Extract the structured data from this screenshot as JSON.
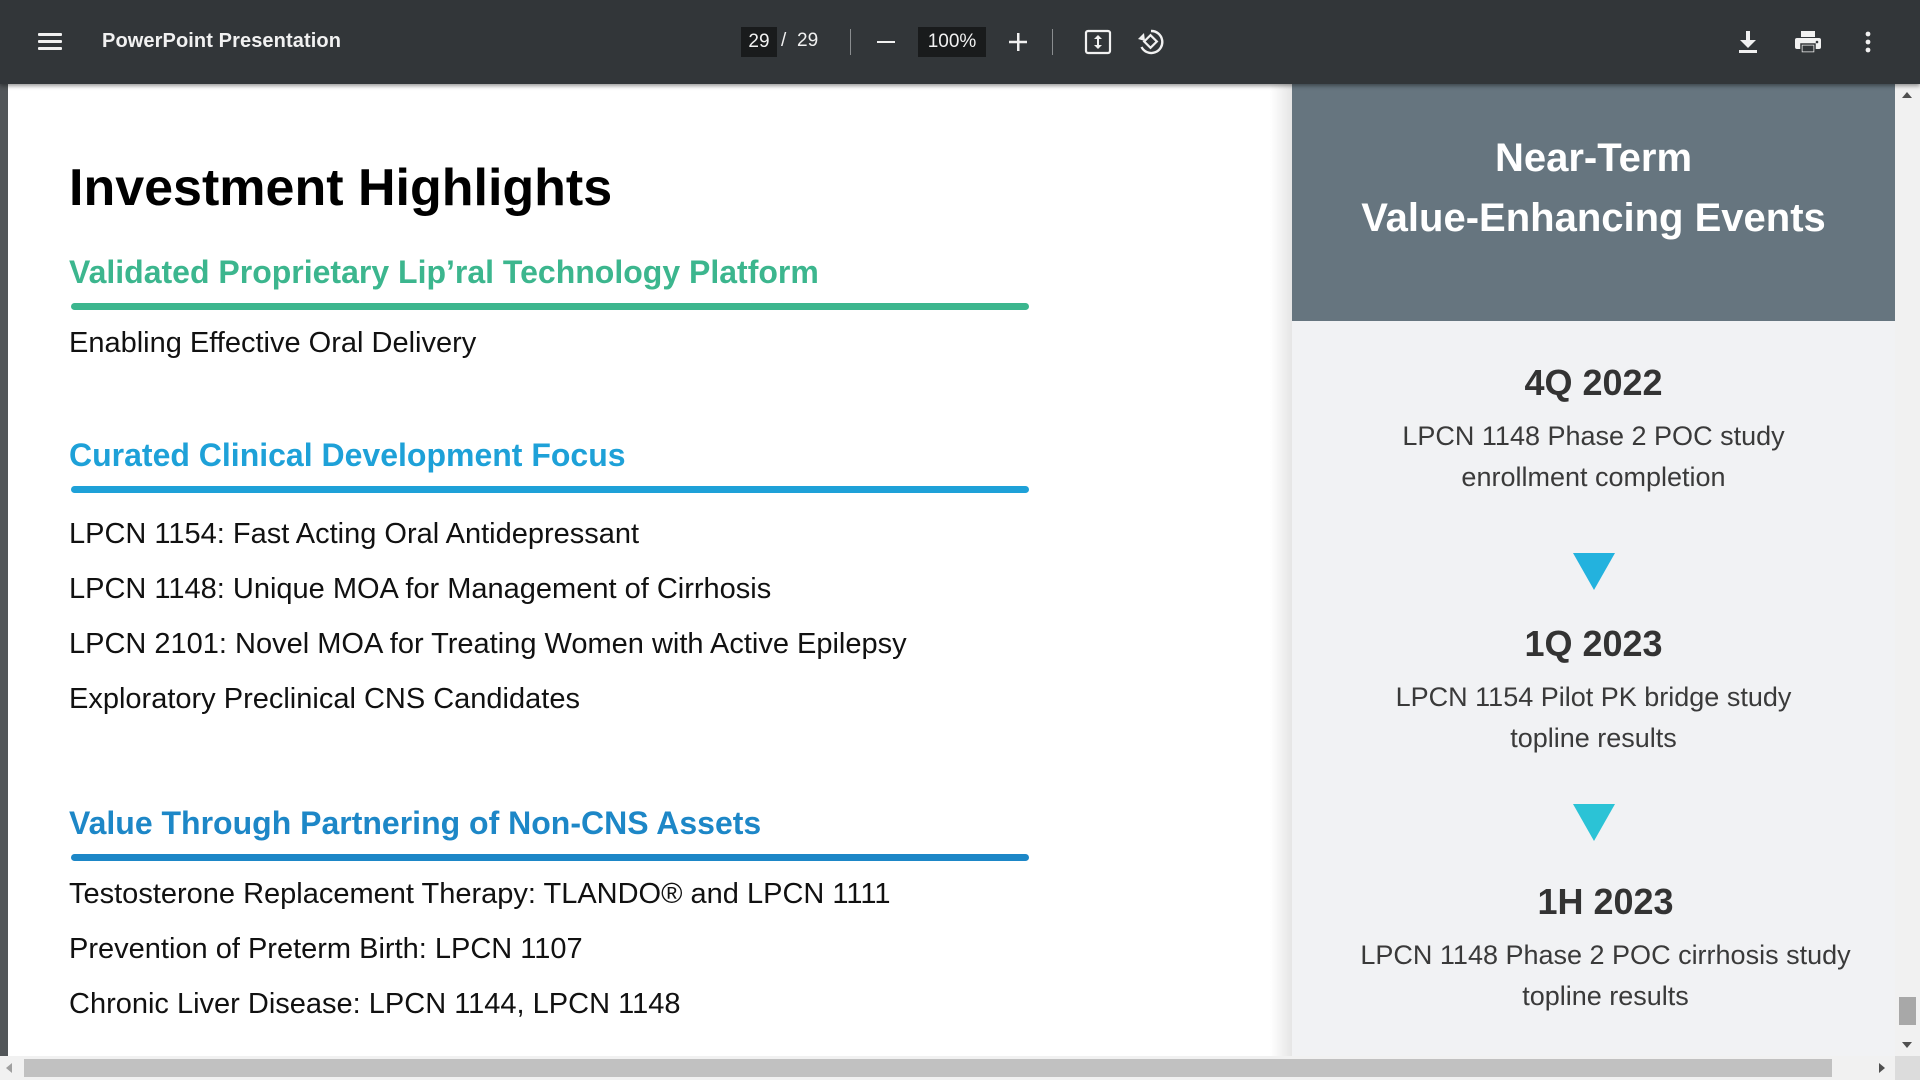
{
  "toolbar": {
    "title": "PowerPoint Presentation",
    "page_current": "29",
    "page_separator": "/",
    "page_total": "29",
    "zoom": "100%",
    "icons": {
      "menu": "hamburger-menu-icon",
      "zoom_out": "minus-icon",
      "zoom_in": "plus-icon",
      "fit": "fit-to-page-icon",
      "rotate": "rotate-counterclockwise-icon",
      "download": "download-icon",
      "print": "printer-icon",
      "more": "more-vertical-icon"
    }
  },
  "slide": {
    "title": "Investment Highlights",
    "sections": [
      {
        "heading": "Validated Proprietary Lip’ral Technology Platform",
        "color": "#3cb68e",
        "items": [
          "Enabling Effective Oral Delivery"
        ]
      },
      {
        "heading": "Curated Clinical Development Focus",
        "color": "#1ea1d8",
        "items": [
          "LPCN 1154: Fast Acting Oral Antidepressant",
          "LPCN 1148: Unique MOA for Management of Cirrhosis",
          "LPCN 2101: Novel MOA for Treating Women with Active Epilepsy",
          "Exploratory Preclinical CNS Candidates"
        ]
      },
      {
        "heading": "Value Through Partnering of Non-CNS Assets",
        "color": "#1d87c7",
        "items": [
          "Testosterone Replacement Therapy: TLANDO®  and LPCN 1111",
          "Prevention of Preterm Birth: LPCN 1107",
          "Chronic Liver Disease: LPCN 1144, LPCN 1148"
        ]
      }
    ],
    "panel": {
      "header_line1": "Near-Term",
      "header_line2": "Value-Enhancing Events",
      "header_color": "#66757f",
      "events": [
        {
          "when": "4Q 2022",
          "line1": "LPCN 1148 Phase 2 POC study",
          "line2": "enrollment completion"
        },
        {
          "when": "1Q 2023",
          "line1": "LPCN 1154 Pilot PK bridge study",
          "line2": "topline results"
        },
        {
          "when": "1H 2023",
          "line1": "LPCN 1148 Phase 2 POC cirrhosis study",
          "line2": "topline results"
        }
      ],
      "arrow_icon": "down-triangle-icon"
    }
  }
}
